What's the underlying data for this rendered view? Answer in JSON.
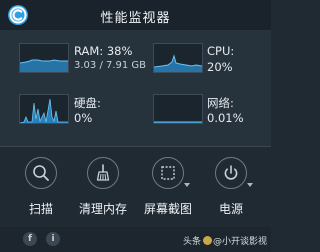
{
  "app": {
    "title": "性能监视器",
    "accent_color": "#2f9fe0"
  },
  "metrics": {
    "ram": {
      "label": "RAM: 38%",
      "detail": "3.03 / 7.91 GB",
      "usage_fraction": 0.38
    },
    "cpu": {
      "label": "CPU:",
      "value": "20%",
      "usage_fraction": 0.2
    },
    "disk": {
      "label": "硬盘:",
      "value": "0%",
      "usage_fraction": 0.0
    },
    "network": {
      "label": "网络:",
      "value": "0.01%",
      "usage_fraction": 0.0001
    }
  },
  "toolbar": {
    "items": [
      {
        "icon": "search-icon",
        "label": "扫描"
      },
      {
        "icon": "broom-icon",
        "label": "清理内存"
      },
      {
        "icon": "screenshot-crop-icon",
        "label": "屏幕截图",
        "has_dropdown": true
      },
      {
        "icon": "power-icon",
        "label": "电源",
        "has_dropdown": true
      }
    ]
  },
  "footer": {
    "facebook_glyph": "f",
    "info_glyph": "i",
    "watermark_prefix": "头条",
    "watermark_text": "@小开谈影视"
  }
}
